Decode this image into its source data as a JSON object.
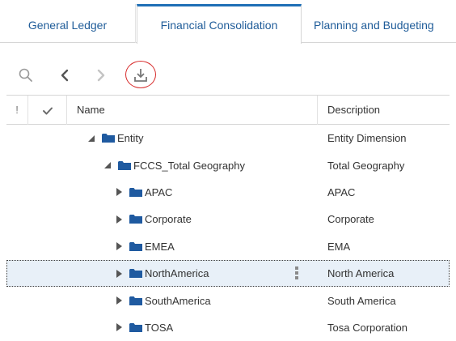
{
  "tabs": [
    {
      "label": "General Ledger"
    },
    {
      "label": "Financial Consolidation",
      "active": true
    },
    {
      "label": "Planning and Budgeting"
    }
  ],
  "toolbar": {
    "icons": [
      "search-icon",
      "chevron-left-icon",
      "chevron-right-icon",
      "download-icon"
    ]
  },
  "table": {
    "headers": {
      "excl": "!",
      "check": "✔",
      "name": "Name",
      "description": "Description"
    },
    "rows": [
      {
        "name": "Entity",
        "description": "Entity Dimension",
        "expanded": true,
        "selected": false
      },
      {
        "name": "FCCS_Total Geography",
        "description": "Total Geography",
        "expanded": true,
        "selected": false
      },
      {
        "name": "APAC",
        "description": "APAC",
        "expanded": false,
        "selected": false
      },
      {
        "name": "Corporate",
        "description": "Corporate",
        "expanded": false,
        "selected": false
      },
      {
        "name": "EMEA",
        "description": "EMA",
        "expanded": false,
        "selected": false
      },
      {
        "name": "NorthAmerica",
        "description": "North America",
        "expanded": false,
        "selected": true
      },
      {
        "name": "SouthAmerica",
        "description": "South America",
        "expanded": false,
        "selected": false
      },
      {
        "name": "TOSA",
        "description": "Tosa Corporation",
        "expanded": false,
        "selected": false
      }
    ]
  },
  "colors": {
    "tab_text": "#1f5c99",
    "folder": "#1f5aa0",
    "highlight": "#d72b2b",
    "selected_row": "#e8f0f8"
  }
}
